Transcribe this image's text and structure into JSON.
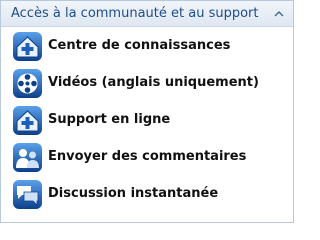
{
  "panel": {
    "title": "Accès à la communauté et au support",
    "collapse_icon": "chevron-up-icon"
  },
  "items": [
    {
      "label": "Centre de connaissances",
      "icon": "knowledge-center-icon"
    },
    {
      "label": "Vidéos (anglais uniquement)",
      "icon": "film-reel-icon"
    },
    {
      "label": "Support en ligne",
      "icon": "online-support-icon"
    },
    {
      "label": "Envoyer des commentaires",
      "icon": "users-feedback-icon"
    },
    {
      "label": "Discussion instantanée",
      "icon": "chat-bubbles-icon"
    }
  ],
  "colors": {
    "title": "#1e4d8c",
    "icon_blue": "#1f5fb8",
    "icon_dark": "#0d3f8a"
  }
}
